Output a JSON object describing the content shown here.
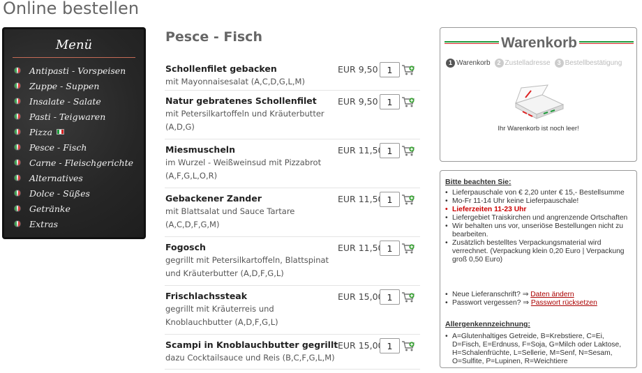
{
  "page": {
    "title": "Online bestellen"
  },
  "menu": {
    "title": "Menü",
    "items": [
      {
        "label": "Antipasti - Vorspeisen"
      },
      {
        "label": "Zuppe - Suppen"
      },
      {
        "label": "Insalate - Salate"
      },
      {
        "label": "Pasti - Teigwaren"
      },
      {
        "label": "Pizza",
        "flag": true
      },
      {
        "label": "Pesce - Fisch"
      },
      {
        "label": "Carne - Fleischgerichte"
      },
      {
        "label": "Alternatives"
      },
      {
        "label": "Dolce - Süßes"
      },
      {
        "label": "Getränke"
      },
      {
        "label": "Extras"
      }
    ]
  },
  "category": {
    "title": "Pesce - Fisch"
  },
  "products": [
    {
      "name": "Schollenfilet gebacken",
      "desc": "mit Mayonnaisesalat (A,C,D,G,L,M)",
      "price": "EUR 9,50",
      "qty": "1"
    },
    {
      "name": "Natur gebratenes Schollenfilet",
      "desc": "mit Petersilkartoffeln und Kräuterbutter (A,D,G)",
      "price": "EUR 9,50",
      "qty": "1"
    },
    {
      "name": "Miesmuscheln",
      "desc": "im Wurzel - Weißweinsud mit Pizzabrot (A,F,G,L,O,R)",
      "price": "EUR 11,50",
      "qty": "1"
    },
    {
      "name": "Gebackener Zander",
      "desc": "mit Blattsalat und Sauce Tartare (A,C,D,F,G,M)",
      "price": "EUR 11,50",
      "qty": "1"
    },
    {
      "name": "Fogosch",
      "desc": "gegrillt mit Petersilkartoffeln, Blattspinat und Kräuterbutter (A,D,F,G,L)",
      "price": "EUR 11,50",
      "qty": "1"
    },
    {
      "name": "Frischlachssteak",
      "desc": "gegrillt mit Kräuterreis und Knoblauchbutter (A,D,F,G,L)",
      "price": "EUR 15,00",
      "qty": "1"
    },
    {
      "name": "Scampi in Knoblauchbutter gegrillt",
      "desc": "dazu Cocktailsauce und Reis (B,C,F,G,L,M)",
      "price": "EUR 15,00",
      "qty": "1"
    }
  ],
  "cart": {
    "title": "Warenkorb",
    "steps": [
      {
        "num": "1",
        "label": "Warenkorb",
        "active": true
      },
      {
        "num": "2",
        "label": "Zustelladresse",
        "active": false
      },
      {
        "num": "3",
        "label": "Bestellbestätigung",
        "active": false
      }
    ],
    "empty_text": "Ihr Warenkorb ist noch leer!"
  },
  "info": {
    "heading": "Bitte beachten Sie:",
    "notes": [
      "Lieferpauschale von € 2,20 unter € 15,- Bestellsumme",
      "Mo-Fr 11-14 Uhr keine Lieferpauschale!",
      "Lieferzeiten 11-23 Uhr",
      "Liefergebiet Traiskirchen und angrenzende Ortschaften",
      "Wir behalten uns vor, unseriöse Bestellungen nicht zu bearbeiten.",
      "Zusätzlich bestelltes Verpackungsmaterial wird verrechnet. (Verpackung klein 0,20 Euro | Verpackung groß 0,50 Euro)"
    ],
    "new_address_text": "Neue Lieferanschrift? ⇒",
    "new_address_link": "Daten ändern",
    "password_text": "Passwort vergessen? ⇒",
    "password_link": "Passwort rücksetzen",
    "allergen_heading": "Allergenkennzeichnung:",
    "allergen_text": "A=Glutenhaltiges Getreide, B=Krebstiere, C=Ei, D=Fisch, E=Erdnuss, F=Soja, G=Milch oder Laktose, H=Schalenfrüchte, L=Sellerie, M=Senf, N=Sesam, O=Sulfite, P=Lupinen, R=Weichtiere"
  },
  "colors": {
    "flag_green": "#1e9a3a",
    "flag_red": "#d22222",
    "link_red": "#a00000",
    "accent_red": "#c00000"
  }
}
